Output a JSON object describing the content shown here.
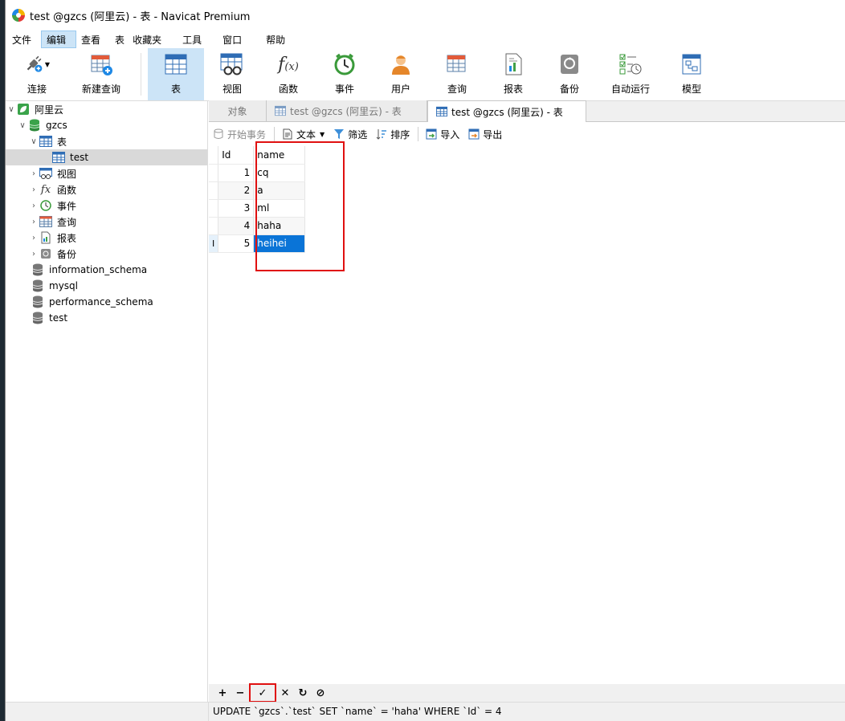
{
  "window": {
    "title": "test @gzcs (阿里云) - 表 - Navicat Premium"
  },
  "menu": [
    "文件",
    "编辑",
    "查看",
    "表",
    "收藏夹",
    "工具",
    "窗口",
    "帮助"
  ],
  "toolbar": [
    {
      "label": "连接",
      "icon": "plug-icon"
    },
    {
      "label": "新建查询",
      "icon": "new-query-icon"
    },
    {
      "label": "表",
      "icon": "table-icon"
    },
    {
      "label": "视图",
      "icon": "view-icon"
    },
    {
      "label": "函数",
      "icon": "function-icon"
    },
    {
      "label": "事件",
      "icon": "clock-icon"
    },
    {
      "label": "用户",
      "icon": "user-icon"
    },
    {
      "label": "查询",
      "icon": "query-icon"
    },
    {
      "label": "报表",
      "icon": "report-icon"
    },
    {
      "label": "备份",
      "icon": "backup-icon"
    },
    {
      "label": "自动运行",
      "icon": "schedule-icon"
    },
    {
      "label": "模型",
      "icon": "model-icon"
    }
  ],
  "sidebar": {
    "connection": "阿里云",
    "database": "gzcs",
    "tables_folder": "表",
    "table": "test",
    "folders": [
      "视图",
      "函数",
      "事件",
      "查询",
      "报表",
      "备份"
    ],
    "other_dbs": [
      "information_schema",
      "mysql",
      "performance_schema",
      "test"
    ]
  },
  "tabs": {
    "objects": "对象",
    "inactive": "test @gzcs (阿里云) - 表",
    "active": "test @gzcs (阿里云) - 表"
  },
  "subtoolbar": {
    "begin_tx": "开始事务",
    "text": "文本",
    "filter": "筛选",
    "sort": "排序",
    "import": "导入",
    "export": "导出"
  },
  "grid": {
    "columns": [
      "Id",
      "name"
    ],
    "rows": [
      {
        "id": "1",
        "name": "cq"
      },
      {
        "id": "2",
        "name": "a"
      },
      {
        "id": "3",
        "name": "ml"
      },
      {
        "id": "4",
        "name": "haha"
      },
      {
        "id": "5",
        "name": "heihei"
      }
    ],
    "cursor_marker": "I"
  },
  "bottom_buttons": [
    "+",
    "−",
    "✓",
    "✕",
    "↻",
    "⊘"
  ],
  "status": {
    "sql": "UPDATE `gzcs`.`test` SET `name` = 'haha' WHERE `Id` = 4"
  },
  "colors": {
    "selection": "#0a74d7",
    "highlight": "#e01010",
    "active_tool": "#cce4f7"
  }
}
